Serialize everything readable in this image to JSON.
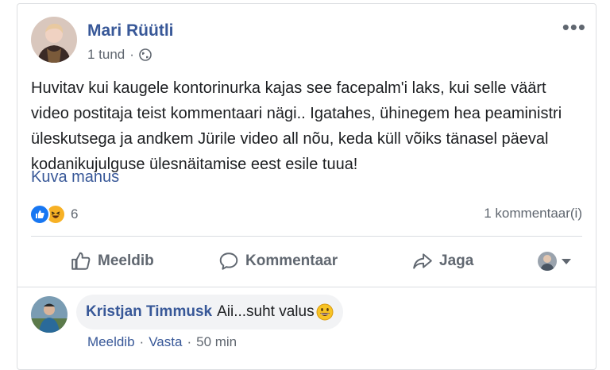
{
  "post": {
    "author": "Mari Rüütli",
    "time": "1 tund",
    "meta_sep": "·",
    "text": "Huvitav kui kaugele kontorinurka kajas see facepalm'i laks, kui selle väärt video postitaja teist kommentaari nägi.. Igatahes, ühinegem hea peaministri üleskutsega ja andkem Jürile video all nõu, keda küll võiks tänasel päeval kodanikujulguse ülesnäitamise eest esile tuua!",
    "see_more": "Kuva manus",
    "reaction_count": "6",
    "comment_count": "1 kommentaar(i)",
    "more_icon": "•••"
  },
  "actions": {
    "like": "Meeldib",
    "comment": "Kommentaar",
    "share": "Jaga"
  },
  "comment": {
    "author": "Kristjan Timmusk",
    "text": "Aii...suht valus",
    "like": "Meeldib",
    "reply": "Vasta",
    "time": "50 min",
    "sep": "·"
  },
  "colors": {
    "link": "#385898",
    "secondary": "#606770",
    "like_blue": "#1877f2",
    "haha_yellow": "#f7b125"
  }
}
